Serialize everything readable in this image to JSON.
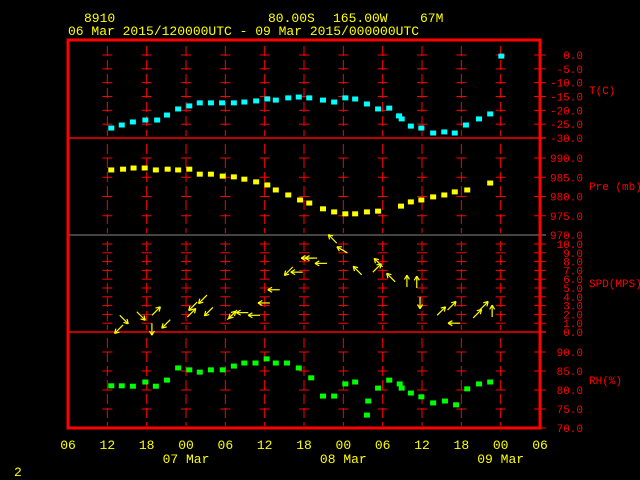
{
  "chart_data": {
    "type": "scatter",
    "title": {
      "station": "8910",
      "latitude": "80.00S",
      "longitude": "165.00W",
      "elevation": "67M",
      "period": "06 Mar 2015/120000UTC - 09 Mar 2015/000000UTC"
    },
    "x_unit": "hours since 06 Mar 2015 12UTC",
    "xlim": [
      -6,
      66
    ],
    "x_ticks": [
      -6,
      0,
      6,
      12,
      18,
      24,
      30,
      36,
      42,
      48,
      54,
      60,
      66
    ],
    "x_tick_labels": [
      "06",
      "12",
      "18",
      "00",
      "06",
      "12",
      "18",
      "00",
      "06",
      "12",
      "18",
      "00",
      "06"
    ],
    "date_labels": [
      {
        "hour": 12,
        "label": "07 Mar"
      },
      {
        "hour": 36,
        "label": "08 Mar"
      },
      {
        "hour": 60,
        "label": "09 Mar"
      }
    ],
    "page_number": "2",
    "colors": {
      "frame": "#ff0000",
      "text": "#ffff00",
      "temperature": "#00ffff",
      "pressure": "#ffff00",
      "wind": "#ffff00",
      "rh": "#00ff00"
    },
    "panels": [
      {
        "id": "temperature",
        "label": "T(C)",
        "ylim": [
          -30,
          0
        ],
        "ticks": [
          0,
          -5,
          -10,
          -15,
          -20,
          -25,
          -30
        ],
        "tick_labels": [
          "0.0",
          "-5.0",
          "-10.0",
          "-15.0",
          "-20.0",
          "-25.0",
          "-30.0"
        ],
        "points": [
          [
            0.6,
            -26.4
          ],
          [
            2.2,
            -25.3
          ],
          [
            3.9,
            -24.2
          ],
          [
            5.8,
            -23.5
          ],
          [
            7.6,
            -23.5
          ],
          [
            9.1,
            -21.7
          ],
          [
            10.8,
            -19.5
          ],
          [
            12.5,
            -18.4
          ],
          [
            14.1,
            -17.3
          ],
          [
            15.8,
            -17.3
          ],
          [
            17.5,
            -17.3
          ],
          [
            19.3,
            -17.3
          ],
          [
            20.9,
            -17.0
          ],
          [
            22.7,
            -16.6
          ],
          [
            24.4,
            -15.9
          ],
          [
            25.7,
            -16.3
          ],
          [
            27.6,
            -15.5
          ],
          [
            29.2,
            -15.2
          ],
          [
            30.8,
            -15.5
          ],
          [
            32.9,
            -16.3
          ],
          [
            34.6,
            -17.0
          ],
          [
            36.3,
            -15.5
          ],
          [
            37.8,
            -15.9
          ],
          [
            39.6,
            -17.7
          ],
          [
            41.3,
            -19.5
          ],
          [
            43.0,
            -19.2
          ],
          [
            44.5,
            -22.0
          ],
          [
            44.9,
            -23.1
          ],
          [
            46.3,
            -25.7
          ],
          [
            47.9,
            -26.4
          ],
          [
            49.7,
            -28.2
          ],
          [
            51.4,
            -27.8
          ],
          [
            53.0,
            -28.2
          ],
          [
            54.7,
            -25.3
          ],
          [
            56.7,
            -23.1
          ],
          [
            58.4,
            -21.3
          ],
          [
            60.1,
            -0.4
          ]
        ]
      },
      {
        "id": "pressure",
        "label": "Pre (mb)",
        "ylim": [
          970,
          995
        ],
        "ticks": [
          990,
          985,
          980,
          975,
          970
        ],
        "tick_labels": [
          "990.0",
          "985.0",
          "980.0",
          "975.0",
          "970.0"
        ],
        "points": [
          [
            0.6,
            986.9
          ],
          [
            2.4,
            987.1
          ],
          [
            4.0,
            987.4
          ],
          [
            5.7,
            987.4
          ],
          [
            7.4,
            986.9
          ],
          [
            9.2,
            987.1
          ],
          [
            10.8,
            986.9
          ],
          [
            12.5,
            987.1
          ],
          [
            14.1,
            985.8
          ],
          [
            15.8,
            985.8
          ],
          [
            17.6,
            985.3
          ],
          [
            19.3,
            985.1
          ],
          [
            20.9,
            984.5
          ],
          [
            22.7,
            983.8
          ],
          [
            24.4,
            983.0
          ],
          [
            25.7,
            981.7
          ],
          [
            27.6,
            980.4
          ],
          [
            29.4,
            979.1
          ],
          [
            30.8,
            978.3
          ],
          [
            32.9,
            976.8
          ],
          [
            34.6,
            976.0
          ],
          [
            36.3,
            975.5
          ],
          [
            37.8,
            975.5
          ],
          [
            39.6,
            976.0
          ],
          [
            41.3,
            976.2
          ],
          [
            44.8,
            977.5
          ],
          [
            46.3,
            978.6
          ],
          [
            47.9,
            979.1
          ],
          [
            49.7,
            979.9
          ],
          [
            51.4,
            980.4
          ],
          [
            53.0,
            981.2
          ],
          [
            54.9,
            981.7
          ],
          [
            58.4,
            983.5
          ]
        ]
      },
      {
        "id": "wind",
        "label": "SPD(MPS)",
        "ylim": [
          0,
          10
        ],
        "ticks": [
          10,
          9,
          8,
          7,
          6,
          5,
          4,
          3,
          2,
          1,
          0
        ],
        "tick_labels": [
          "10.0",
          "9.0",
          "8.0",
          "7.0",
          "6.0",
          "5.0",
          "4.0",
          "3.0",
          "2.0",
          "1.0",
          "0.0"
        ],
        "points_hour_speed_arrowdir": [
          [
            1.9,
            1.9,
            135
          ],
          [
            2.4,
            0.8,
            225
          ],
          [
            4.5,
            2.3,
            135
          ],
          [
            6.8,
            1.9,
            45
          ],
          [
            6.8,
            1.0,
            180
          ],
          [
            9.6,
            1.4,
            225
          ],
          [
            12.2,
            1.7,
            45
          ],
          [
            13.7,
            3.4,
            225
          ],
          [
            15.2,
            4.2,
            225
          ],
          [
            16.1,
            2.8,
            225
          ],
          [
            18.3,
            1.4,
            45
          ],
          [
            19.8,
            2.5,
            225
          ],
          [
            21.5,
            2.2,
            270
          ],
          [
            23.3,
            1.9,
            270
          ],
          [
            24.8,
            3.3,
            270
          ],
          [
            26.3,
            4.8,
            270
          ],
          [
            28.3,
            7.4,
            225
          ],
          [
            29.8,
            6.8,
            270
          ],
          [
            31.4,
            8.4,
            270
          ],
          [
            32.0,
            8.4,
            270
          ],
          [
            33.5,
            7.8,
            270
          ],
          [
            35.0,
            10.1,
            315
          ],
          [
            36.6,
            9.0,
            300
          ],
          [
            38.8,
            6.5,
            315
          ],
          [
            40.5,
            6.8,
            45
          ],
          [
            42.0,
            7.4,
            315
          ],
          [
            43.9,
            5.7,
            315
          ],
          [
            45.7,
            5.1,
            0
          ],
          [
            47.2,
            5.0,
            0
          ],
          [
            47.7,
            4.0,
            180
          ],
          [
            50.3,
            1.9,
            45
          ],
          [
            51.9,
            2.5,
            45
          ],
          [
            53.8,
            1.0,
            270
          ],
          [
            55.8,
            1.6,
            45
          ],
          [
            56.8,
            2.5,
            45
          ],
          [
            58.7,
            1.7,
            0
          ]
        ]
      },
      {
        "id": "rh",
        "label": "RH(%)",
        "ylim": [
          70,
          90
        ],
        "ticks": [
          90,
          85,
          80,
          75,
          70
        ],
        "tick_labels": [
          "90.0",
          "85.0",
          "80.0",
          "75.0",
          "70.0"
        ],
        "points": [
          [
            0.6,
            81.1
          ],
          [
            2.2,
            81.1
          ],
          [
            3.9,
            81.0
          ],
          [
            5.8,
            82.1
          ],
          [
            7.4,
            81.0
          ],
          [
            9.1,
            82.6
          ],
          [
            10.8,
            85.8
          ],
          [
            12.5,
            85.3
          ],
          [
            14.1,
            84.7
          ],
          [
            15.8,
            85.3
          ],
          [
            17.6,
            85.3
          ],
          [
            19.3,
            86.3
          ],
          [
            20.9,
            87.1
          ],
          [
            22.6,
            87.1
          ],
          [
            24.3,
            88.2
          ],
          [
            25.7,
            87.1
          ],
          [
            27.4,
            87.1
          ],
          [
            29.2,
            85.8
          ],
          [
            31.1,
            83.2
          ],
          [
            32.9,
            78.4
          ],
          [
            34.6,
            78.4
          ],
          [
            36.3,
            81.6
          ],
          [
            37.8,
            82.1
          ],
          [
            39.8,
            77.1
          ],
          [
            39.6,
            73.4
          ],
          [
            41.3,
            80.5
          ],
          [
            43.0,
            82.6
          ],
          [
            44.6,
            81.6
          ],
          [
            44.9,
            80.5
          ],
          [
            46.3,
            79.2
          ],
          [
            47.9,
            78.2
          ],
          [
            49.7,
            76.6
          ],
          [
            51.5,
            77.1
          ],
          [
            53.2,
            76.1
          ],
          [
            54.9,
            80.3
          ],
          [
            56.7,
            81.6
          ],
          [
            58.4,
            82.1
          ]
        ]
      }
    ]
  }
}
